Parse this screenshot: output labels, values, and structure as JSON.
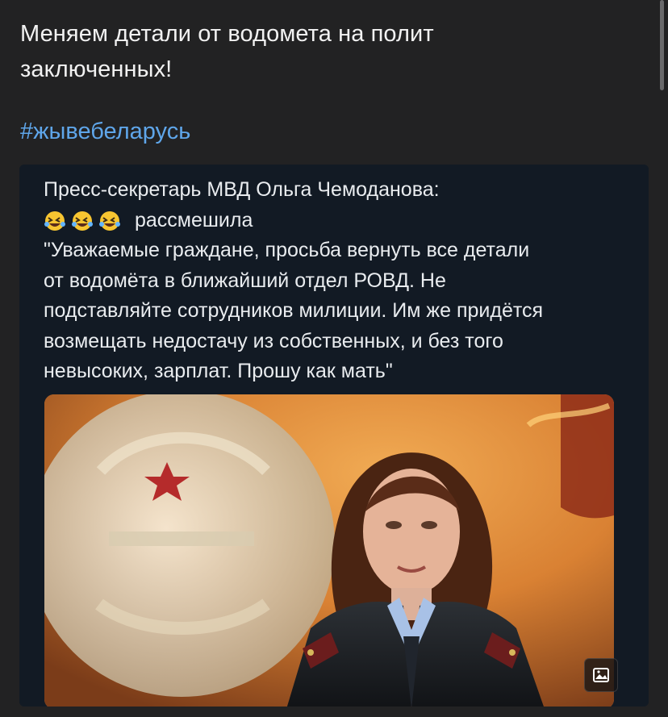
{
  "post": {
    "text_line1": "Меняем детали от водомета на полит",
    "text_line2": "заключенных!",
    "hashtag": "#жывебеларусь"
  },
  "screenshot": {
    "line1": "Пресс-секретарь МВД Ольга Чемоданова:",
    "line2_suffix": "рассмешила",
    "quote_lines": [
      "\"Уважаемые граждане, просьба вернуть все детали",
      "от водомёта в ближайший отдел РОВД. Не",
      "подставляйте сотрудников милиции. Им же придётся",
      "возмещать недостачу из собственных, и без того",
      "невысоких, зарплат. Прошу как мать\""
    ],
    "emoji": [
      "rolling-on-floor-laughing-emoji",
      "rolling-on-floor-laughing-emoji",
      "rolling-on-floor-laughing-emoji"
    ]
  },
  "media_badge": {
    "icon": "image-icon"
  },
  "colors": {
    "background": "#222223",
    "text": "#f2f2f2",
    "hashtag": "#5fa6ea",
    "card": "#121a24"
  }
}
